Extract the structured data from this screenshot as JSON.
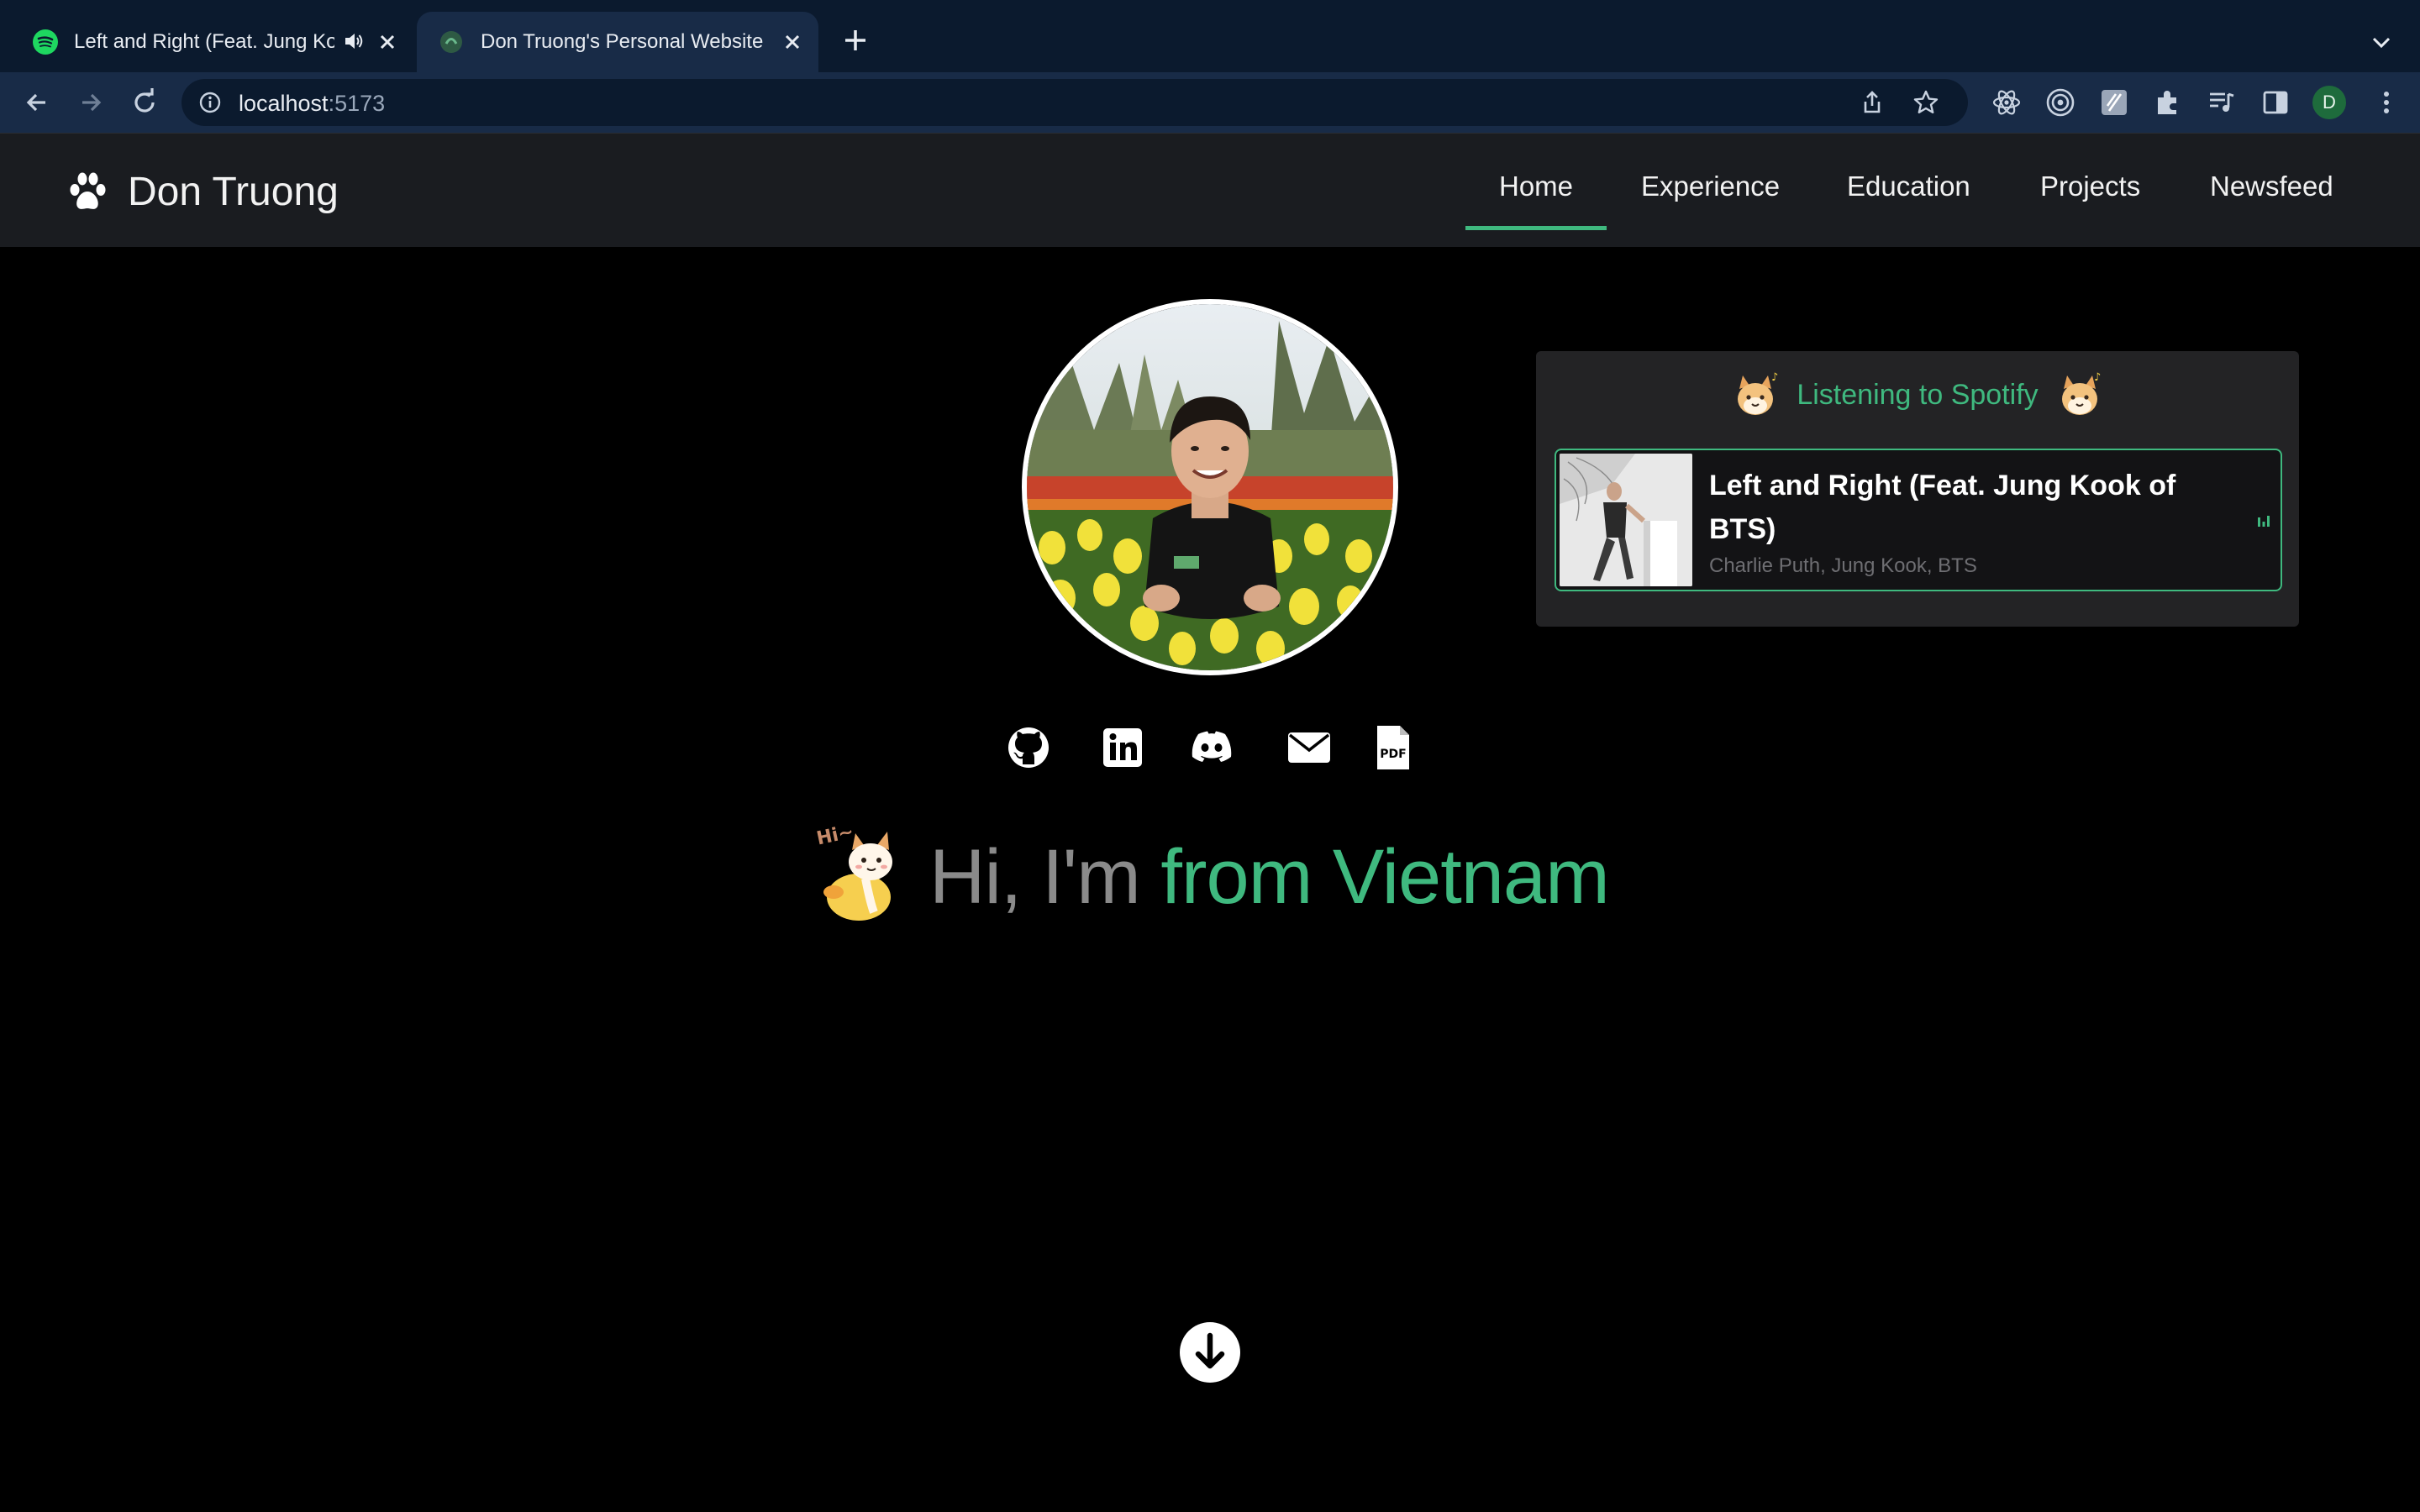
{
  "browser": {
    "tabs": [
      {
        "title": "Left and Right (Feat. Jung Kook of BTS) · Charlie Puth",
        "active": false,
        "playing_audio": true
      },
      {
        "title": "Don Truong's Personal Website",
        "active": true
      }
    ],
    "url": {
      "host": "localhost",
      "port": ":5173"
    },
    "profile_initial": "D",
    "colors": {
      "tabbar": "#0b1a2e",
      "toolbar": "#182b47"
    }
  },
  "site": {
    "brand": "Don Truong",
    "nav": [
      {
        "label": "Home",
        "active": true
      },
      {
        "label": "Experience"
      },
      {
        "label": "Education"
      },
      {
        "label": "Projects"
      },
      {
        "label": "Newsfeed"
      }
    ],
    "accent_color": "#3fb97f"
  },
  "spotify": {
    "header": "Listening to Spotify",
    "track": {
      "title": "Left and Right (Feat. Jung Kook of BTS)",
      "artists": "Charlie Puth, Jung Kook, BTS"
    }
  },
  "socials": [
    {
      "icon": "github-icon"
    },
    {
      "icon": "linkedin-icon"
    },
    {
      "icon": "discord-icon"
    },
    {
      "icon": "email-icon"
    },
    {
      "icon": "pdf-icon"
    }
  ],
  "hero": {
    "intro": "Hi, I'm",
    "rotating_text": "from Vietnam",
    "sticker_text": "Hi~"
  }
}
